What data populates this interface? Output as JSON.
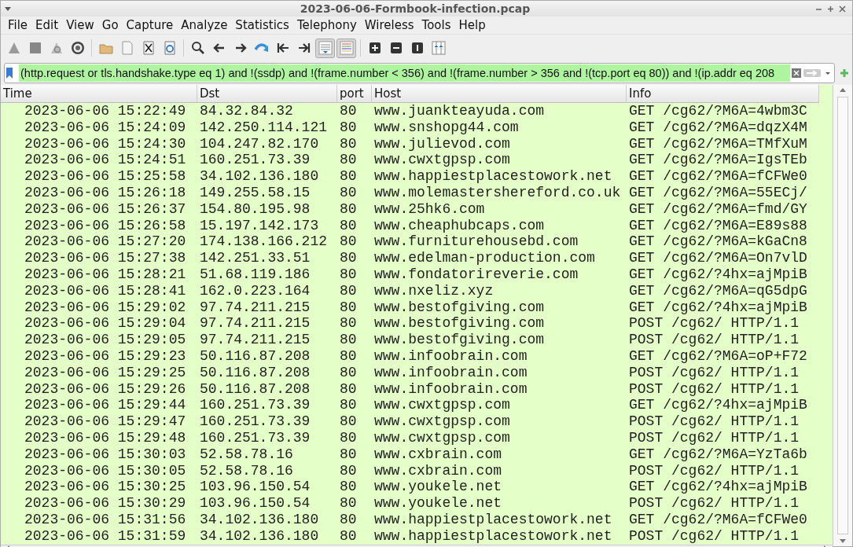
{
  "window": {
    "title": "2023-06-06-Formbook-infection.pcap"
  },
  "menu": [
    "File",
    "Edit",
    "View",
    "Go",
    "Capture",
    "Analyze",
    "Statistics",
    "Telephony",
    "Wireless",
    "Tools",
    "Help"
  ],
  "toolbar": [
    {
      "pressed": false
    },
    {
      "pressed": false
    },
    {
      "pressed": false
    },
    {
      "pressed": false
    },
    {
      "pressed": false
    },
    {
      "pressed": false
    },
    {
      "pressed": false
    },
    {
      "pressed": false
    },
    {
      "pressed": false
    },
    {
      "pressed": false
    },
    {
      "pressed": false
    },
    {
      "pressed": false
    },
    {
      "pressed": false
    },
    {
      "pressed": false
    },
    {
      "pressed": true
    },
    {
      "pressed": true
    },
    {
      "pressed": false
    },
    {
      "pressed": false
    },
    {
      "pressed": false
    },
    {
      "pressed": false
    }
  ],
  "filter": {
    "value": "(http.request or tls.handshake.type eq 1) and !(ssdp) and !(frame.number < 356) and !(frame.number > 356 and !(tcp.port eq 80)) and !(ip.addr eq 208"
  },
  "table": {
    "columns": [
      "Time",
      "Dst",
      "port",
      "Host",
      "Info"
    ],
    "rows": [
      [
        "2023-06-06 15:22:49",
        "84.32.84.32",
        "80",
        "www.juankteayuda.com",
        "GET /cg62/?M6A=4wbm3C"
      ],
      [
        "2023-06-06 15:24:09",
        "142.250.114.121",
        "80",
        "www.snshopg44.com",
        "GET /cg62/?M6A=dqzX4M"
      ],
      [
        "2023-06-06 15:24:30",
        "104.247.82.170",
        "80",
        "www.julievod.com",
        "GET /cg62/?M6A=TMfXuM"
      ],
      [
        "2023-06-06 15:24:51",
        "160.251.73.39",
        "80",
        "www.cwxtgpsp.com",
        "GET /cg62/?M6A=IgsTEb"
      ],
      [
        "2023-06-06 15:25:58",
        "34.102.136.180",
        "80",
        "www.happiestplacestowork.net",
        "GET /cg62/?M6A=fCFWe0"
      ],
      [
        "2023-06-06 15:26:18",
        "149.255.58.15",
        "80",
        "www.molemastershereford.co.uk",
        "GET /cg62/?M6A=55ECj/"
      ],
      [
        "2023-06-06 15:26:37",
        "154.80.195.98",
        "80",
        "www.25hk6.com",
        "GET /cg62/?M6A=fmd/GY"
      ],
      [
        "2023-06-06 15:26:58",
        "15.197.142.173",
        "80",
        "www.cheaphubcaps.com",
        "GET /cg62/?M6A=E89s88"
      ],
      [
        "2023-06-06 15:27:20",
        "174.138.166.212",
        "80",
        "www.furniturehousebd.com",
        "GET /cg62/?M6A=kGaCn8"
      ],
      [
        "2023-06-06 15:27:38",
        "142.251.33.51",
        "80",
        "www.edelman-production.com",
        "GET /cg62/?M6A=On7vlD"
      ],
      [
        "2023-06-06 15:28:21",
        "51.68.119.186",
        "80",
        "www.fondatorireverie.com",
        "GET /cg62/?4hx=ajMpiB"
      ],
      [
        "2023-06-06 15:28:41",
        "162.0.223.164",
        "80",
        "www.nxeliz.xyz",
        "GET /cg62/?M6A=qG5dpG"
      ],
      [
        "2023-06-06 15:29:02",
        "97.74.211.215",
        "80",
        "www.bestofgiving.com",
        "GET /cg62/?4hx=ajMpiB"
      ],
      [
        "2023-06-06 15:29:04",
        "97.74.211.215",
        "80",
        "www.bestofgiving.com",
        "POST /cg62/ HTTP/1.1"
      ],
      [
        "2023-06-06 15:29:05",
        "97.74.211.215",
        "80",
        "www.bestofgiving.com",
        "POST /cg62/ HTTP/1.1"
      ],
      [
        "2023-06-06 15:29:23",
        "50.116.87.208",
        "80",
        "www.infoobrain.com",
        "GET /cg62/?M6A=oP+F72"
      ],
      [
        "2023-06-06 15:29:25",
        "50.116.87.208",
        "80",
        "www.infoobrain.com",
        "POST /cg62/ HTTP/1.1"
      ],
      [
        "2023-06-06 15:29:26",
        "50.116.87.208",
        "80",
        "www.infoobrain.com",
        "POST /cg62/ HTTP/1.1"
      ],
      [
        "2023-06-06 15:29:44",
        "160.251.73.39",
        "80",
        "www.cwxtgpsp.com",
        "GET /cg62/?4hx=ajMpiB"
      ],
      [
        "2023-06-06 15:29:47",
        "160.251.73.39",
        "80",
        "www.cwxtgpsp.com",
        "POST /cg62/ HTTP/1.1"
      ],
      [
        "2023-06-06 15:29:48",
        "160.251.73.39",
        "80",
        "www.cwxtgpsp.com",
        "POST /cg62/ HTTP/1.1"
      ],
      [
        "2023-06-06 15:30:03",
        "52.58.78.16",
        "80",
        "www.cxbrain.com",
        "GET /cg62/?M6A=YzTa6b"
      ],
      [
        "2023-06-06 15:30:05",
        "52.58.78.16",
        "80",
        "www.cxbrain.com",
        "POST /cg62/ HTTP/1.1"
      ],
      [
        "2023-06-06 15:30:25",
        "103.96.150.54",
        "80",
        "www.youkele.net",
        "GET /cg62/?4hx=ajMpiB"
      ],
      [
        "2023-06-06 15:30:29",
        "103.96.150.54",
        "80",
        "www.youkele.net",
        "POST /cg62/ HTTP/1.1"
      ],
      [
        "2023-06-06 15:31:56",
        "34.102.136.180",
        "80",
        "www.happiestplacestowork.net",
        "GET /cg62/?M6A=fCFWe0"
      ],
      [
        "2023-06-06 15:31:59",
        "34.102.136.180",
        "80",
        "www.happiestplacestowork.net",
        "POST /cg62/ HTTP/1.1"
      ]
    ]
  }
}
